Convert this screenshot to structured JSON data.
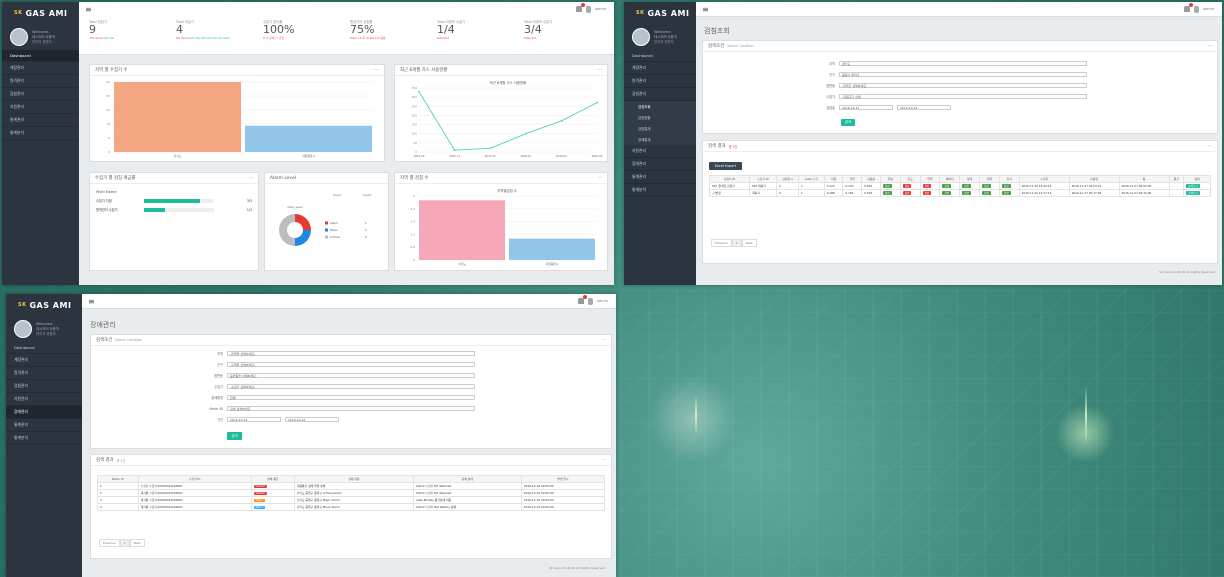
{
  "brand": {
    "sk": "SK",
    "name": "GAS AMI"
  },
  "user": {
    "greet": "Welcome,",
    "name": "대시보드사용자",
    "role": "관리자 권한자"
  },
  "topbar": {
    "user": "admin"
  },
  "sidebar1": [
    "Dashboard",
    "계량관리",
    "원격관리",
    "검침관리",
    "자원관리",
    "통계관리",
    "통계분석"
  ],
  "sidebar2": [
    "Dashboard",
    "계량관리",
    "원격관리",
    "검침관리",
    "검침조회",
    "검침현황",
    "검침통계",
    "장애통계",
    "자원관리",
    "장애관리",
    "통계관리",
    "통계분석"
  ],
  "sidebar3": [
    "Dashboard",
    "계량관리",
    "원격관리",
    "검침관리",
    "자원관리",
    "장애관리",
    "통계관리",
    "통계분석"
  ],
  "stats": [
    {
      "label": "Total 검침기",
      "value": "9",
      "sub_a": "-0% Good",
      "sub_b": "0/0 Idle"
    },
    {
      "label": "Total 미검기",
      "value": "4",
      "sub_a": "0% Good",
      "sub_b": "0/0 Idle 0/0 Idle 0/0 unknown"
    },
    {
      "label": "수집기 접속률",
      "value": "100%",
      "sub_a": "0 /7 출력 /7 출입",
      "sub_b": ""
    },
    {
      "label": "원검기의 검침률",
      "value": "75%",
      "sub_a": "Total >4 후 /0 0/4 1/0 정상",
      "sub_b": ""
    },
    {
      "label": "Total 리데빅 수집기",
      "value": "1/4",
      "sub_a": "Total 0/4",
      "sub_b": ""
    },
    {
      "label": "Total 리데빅 수집기",
      "value": "3/4",
      "sub_a": "Total 3/4",
      "sub_b": ""
    }
  ],
  "boxes": {
    "b1": "지역 별 수집기 수",
    "b2": "최근 6개월 가스 사용현황",
    "b2_chart_title": "최근 6개월 가스 사용현황",
    "b3": "수집기 별 검침 계급률",
    "b4": "Alarm Level",
    "b5": "지역 별 검침 수",
    "b5_chart_title": "지역별검침 수"
  },
  "chart_data": [
    {
      "type": "bar",
      "categories": [
        "경기도",
        "지원중앙시"
      ],
      "values": [
        40,
        15
      ],
      "ylim": [
        0,
        40
      ]
    },
    {
      "type": "line",
      "x": [
        "2015-10",
        "2015-11",
        "2015-12",
        "2016-01",
        "2016-02",
        "2016-03"
      ],
      "values": [
        330,
        10,
        20,
        100,
        170,
        270
      ],
      "ylim": [
        0,
        350
      ]
    },
    {
      "type": "pie",
      "title": "Alarm Level",
      "categories": [
        "Alarm",
        "Major",
        "Critical"
      ],
      "values": [
        1,
        1,
        2
      ],
      "colors": [
        "#e53935",
        "#1e88e5",
        "#bdbdbd"
      ]
    },
    {
      "type": "bar",
      "categories": [
        "경기도",
        "지원중앙시"
      ],
      "values": [
        2.8,
        1
      ],
      "ylim": [
        0,
        3
      ]
    }
  ],
  "b3_content": {
    "head": "Multi Name",
    "rows": [
      {
        "name": "수집기 지정",
        "val": "3/3",
        "pct": 80
      },
      {
        "name": "원격관리 수집기",
        "val": "1/3",
        "pct": 30
      }
    ]
  },
  "alarm_legend": {
    "head1": "Count",
    "head2": "Count",
    "items": [
      {
        "name": "Alarm",
        "val": "1"
      },
      {
        "name": "Major",
        "val": "1"
      },
      {
        "name": "Critical",
        "val": "2"
      }
    ]
  },
  "p2": {
    "title": "검침조회",
    "search_box": "검색조건",
    "search_sub": "Search Condition",
    "fields": [
      {
        "k": "지역",
        "v": "경기도"
      },
      {
        "k": "군구",
        "v": "중원시 빌라구"
      },
      {
        "k": "읍면동",
        "v": "-지역구 선택하세요-"
      },
      {
        "k": "수집기",
        "v": "-지원구기 선택-"
      },
      {
        "k": "검침일",
        "v": "2016-10-21",
        "v2": "2016-10-22"
      }
    ],
    "search_btn": "검색",
    "result_box": "검색 결과",
    "result_sub": "총 2건",
    "excel_btn": "Excel Export",
    "headers": [
      "검침기 ID",
      "수집기 ID",
      "검침일시",
      "LoRa 수신",
      "지침",
      "전일",
      "사용량",
      "유량",
      "온도",
      "압력",
      "배터리",
      "상태",
      "전원",
      "전자",
      "수집일",
      "전송일",
      "동",
      "통신",
      "상세"
    ],
    "rows": [
      [
        "SKT_원격검 검침기",
        "SKT 계량기",
        "0",
        "1",
        "0.123",
        "0.120",
        "0.003",
        "정상",
        "정상",
        "정상",
        "정상",
        "정상",
        "정상",
        "정상",
        "2016-11-23 15:40:14",
        "2016-11-27 03:03:01",
        "2016-11-27 00:00:00",
        "-",
        "상세보기"
      ],
      [
        "-기본형",
        "계측기",
        "0",
        "1",
        "0.168",
        "0.165",
        "0.003",
        "정상",
        "정상",
        "정상",
        "정상",
        "정상",
        "정상",
        "정상",
        "2016-11-22 12:37:13",
        "2016-11-27 05:17:04",
        "2016-11-27 02:10:00",
        "-",
        "상세보기"
      ]
    ],
    "prev": "Previous",
    "page": "1",
    "next": "Next",
    "footer": "SK Gas Ami 2016 All Rights Reserved."
  },
  "p3": {
    "title": "장애관리",
    "search_box": "검색조건",
    "search_sub": "Search Condition",
    "fields": [
      {
        "k": "지역",
        "v": "-지역을 선택하세요-"
      },
      {
        "k": "군구",
        "v": "-구역을 선택하세요-"
      },
      {
        "k": "읍면동",
        "v": "읍면동을 선택하세요-"
      },
      {
        "k": "수집기",
        "v": "-수집기 선택하세요-"
      },
      {
        "k": "장애종류",
        "v": "전체"
      },
      {
        "k": "Meter ID",
        "v": "검색 검색하세요"
      },
      {
        "k": "기간",
        "v": "2016-10-21",
        "v2": "2016-10-22"
      }
    ],
    "search_btn": "검색",
    "result_box": "검색 결과",
    "result_sub": "총 4건",
    "headers": [
      "Meter ID",
      "수집기 ID",
      "장애 종류",
      "장애 내용",
      "장애 상태",
      "발생 일시"
    ],
    "rows": [
      [
        "1",
        "수집기 수집기/20160322200001",
        "Critical",
        "계량통신 장애 발생 장애",
        "0x0x0 수집기 Bit detected",
        "2016-12-19 00:00:00"
      ],
      [
        "2",
        "계기통 수집기/20160322200001",
        "Critical",
        "경기도 중원구 중원구 Critical Alarm",
        "0x0x0 수집기 Bit detected",
        "2016-12-19 00:00:00"
      ],
      [
        "3",
        "계기통 수집기/20160322200001",
        "Major",
        "경기도 중원구 중원구 Major Alarm",
        "LoRa Module 통신장애 이중",
        "2016-12-19 00:00:00"
      ],
      [
        "4",
        "계기통 수집기/20160322200001",
        "Minor",
        "경기도 중원구 중원구 Minor Alarm",
        "0x0x0 수집기 Bat battery 장애",
        "2016-12-19 00:00:00"
      ]
    ],
    "tag_colors": {
      "Critical": "#e53935",
      "Major": "#fb8c00",
      "Minor": "#29b6f6"
    },
    "prev": "Previous",
    "page": "1",
    "next": "Next",
    "footer": "SK Gas Ami 2016 All Rights Reserved."
  }
}
